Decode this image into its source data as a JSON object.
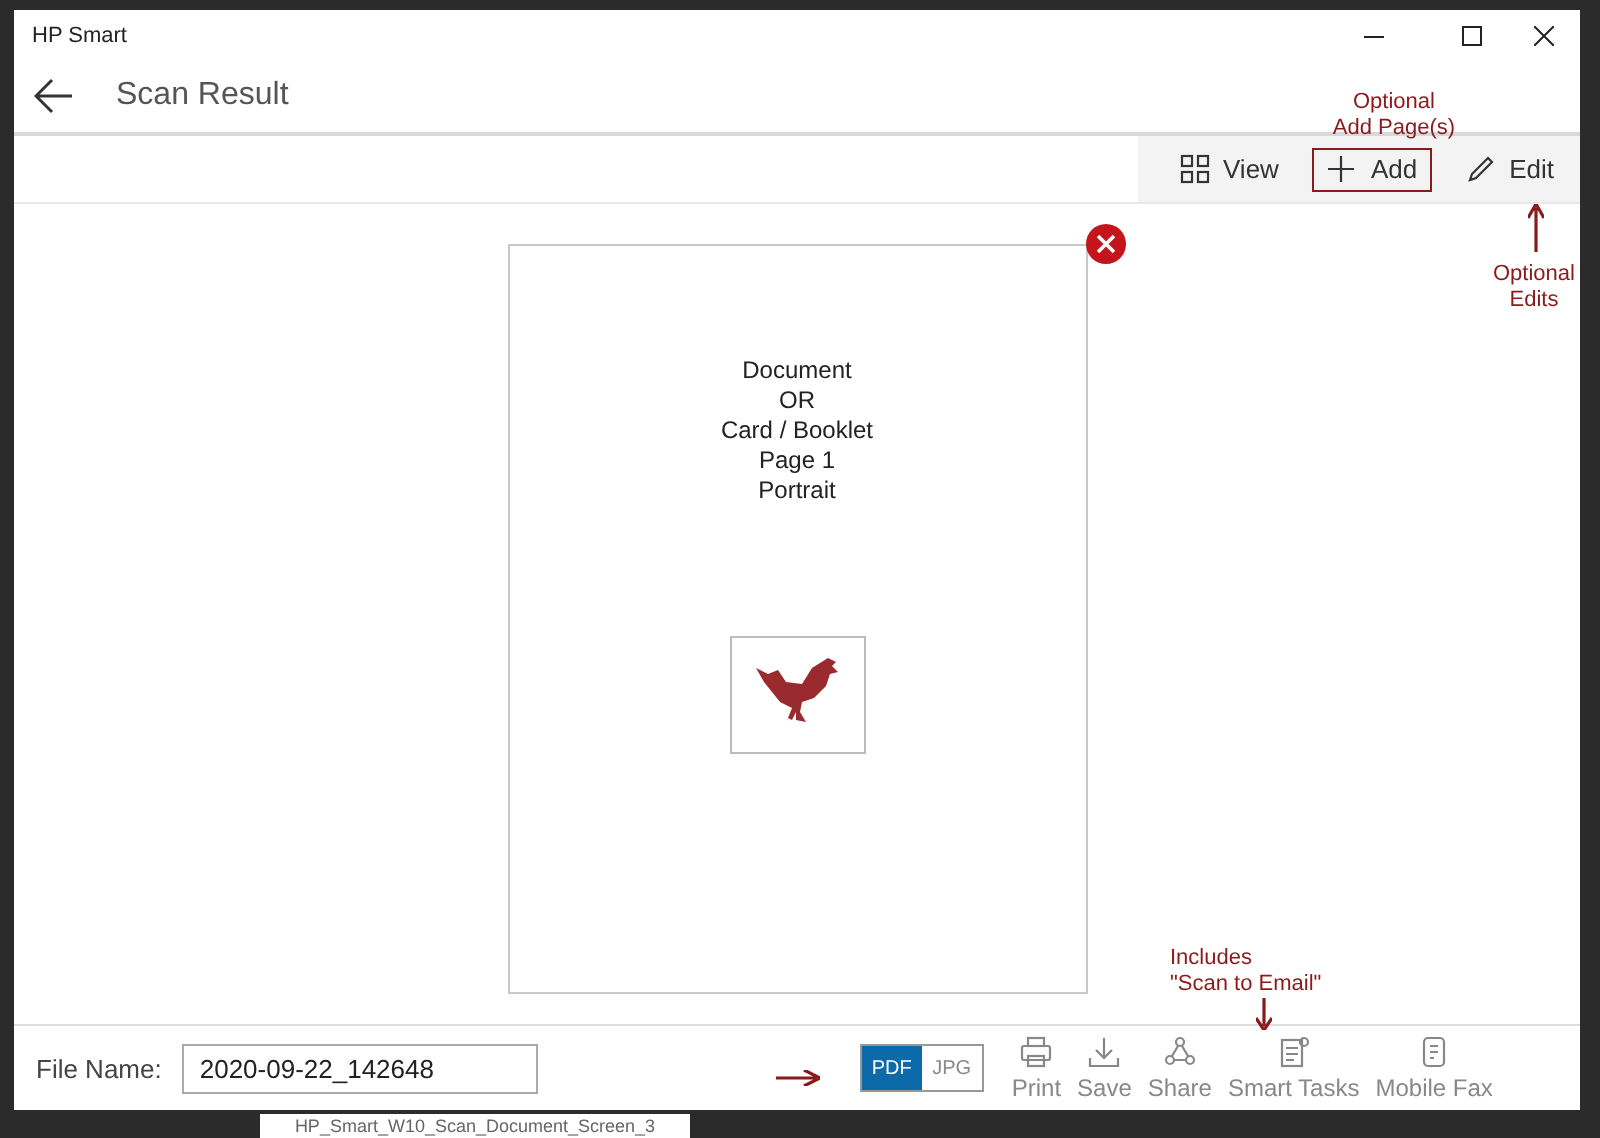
{
  "window": {
    "title": "HP Smart"
  },
  "header": {
    "title": "Scan Result"
  },
  "toolbar": [
    {
      "label": "View",
      "highlighted": false
    },
    {
      "label": "Add",
      "highlighted": true
    },
    {
      "label": "Edit",
      "highlighted": false
    }
  ],
  "page": {
    "lines": [
      "Document",
      "OR",
      "Card / Booklet",
      "Page 1",
      "Portrait"
    ]
  },
  "file_name": {
    "label": "File Name:",
    "value": "2020-09-22_142648"
  },
  "format": [
    {
      "label": "PDF",
      "selected": true
    },
    {
      "label": "JPG",
      "selected": false
    }
  ],
  "actions": [
    {
      "label": "Print"
    },
    {
      "label": "Save"
    },
    {
      "label": "Share"
    },
    {
      "label": "Smart Tasks"
    },
    {
      "label": "Mobile Fax"
    }
  ],
  "annotations": [
    {
      "kind": "note",
      "text": "Optional\nAdd Page(s)"
    },
    {
      "kind": "note_arrow_up",
      "text": "Optional\nEdits"
    },
    {
      "kind": "note_arrow_down",
      "text": "Includes\n\"Scan to Email\""
    },
    {
      "kind": "arrow_right"
    }
  ],
  "caption": "HP_Smart_W10_Scan_Document_Screen_3"
}
